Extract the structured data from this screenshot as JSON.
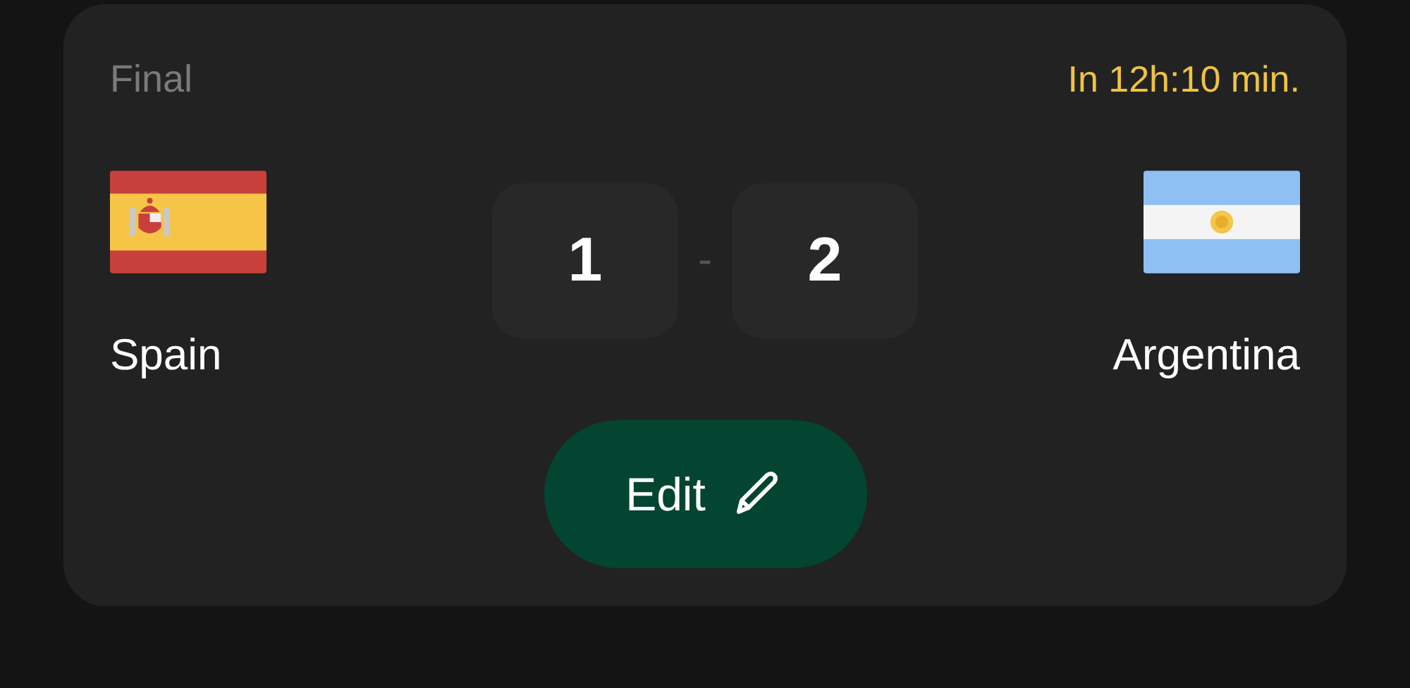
{
  "match": {
    "stage": "Final",
    "countdown": "In 12h:10 min."
  },
  "teams": [
    {
      "name": "Spain",
      "kind": "spain"
    },
    {
      "name": "Argentina",
      "kind": "argentina"
    }
  ],
  "score": {
    "home": "1",
    "separator": "-",
    "away": "2"
  },
  "edit_button": {
    "label": "Edit"
  }
}
